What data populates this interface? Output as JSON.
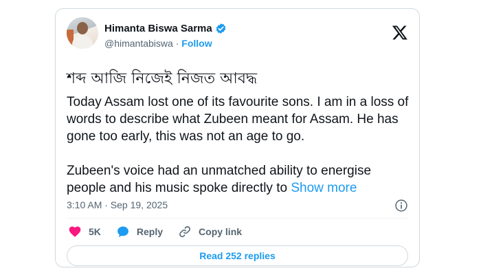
{
  "author": {
    "name": "Himanta Biswa Sarma",
    "handle": "@himantabiswa",
    "separator": " · ",
    "follow_label": "Follow",
    "verified": true
  },
  "tweet": {
    "headline": "শব্দ আজি নিজেই নিজত আবদ্ধ",
    "paragraph1": "Today Assam lost one of its favourite sons. I am in a loss of words to describe what Zubeen meant for Assam. He has gone too early, this was not an age to go.",
    "paragraph2": "Zubeen's voice had an unmatched ability to energise people and his music spoke directly to ",
    "show_more_label": "Show more",
    "timestamp": "3:10 AM · Sep 19, 2025"
  },
  "actions": {
    "likes": {
      "icon": "heart-icon",
      "label": "5K"
    },
    "reply": {
      "icon": "reply-bubble-icon",
      "label": "Reply"
    },
    "copy_link": {
      "icon": "link-icon",
      "label": "Copy link"
    }
  },
  "read_replies_label": "Read 252 replies",
  "colors": {
    "accent": "#1d9bf0",
    "like": "#f91880",
    "text": "#0f1419",
    "muted": "#536471",
    "border": "#cfd9de"
  }
}
